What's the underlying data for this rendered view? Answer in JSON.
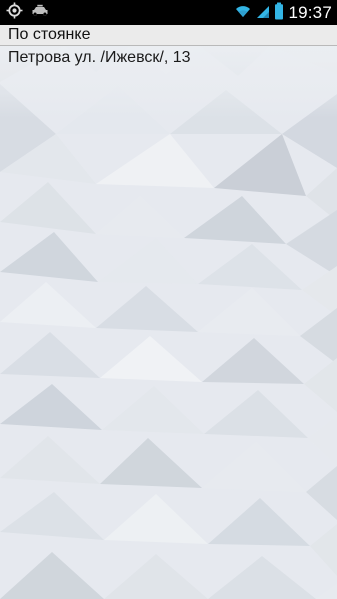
{
  "status_bar": {
    "time": "19:37",
    "icons": {
      "left": [
        "location-target-icon",
        "taxi-car-icon"
      ],
      "right": [
        "wifi-icon",
        "signal-icon",
        "battery-icon"
      ]
    }
  },
  "header": {
    "title": "По стоянке"
  },
  "main": {
    "address": "Петрова ул. /Ижевск/, 13"
  },
  "colors": {
    "status_bar_bg": "#000000",
    "header_bg": "#ebebeb",
    "background_base": "#e6e9ef"
  }
}
